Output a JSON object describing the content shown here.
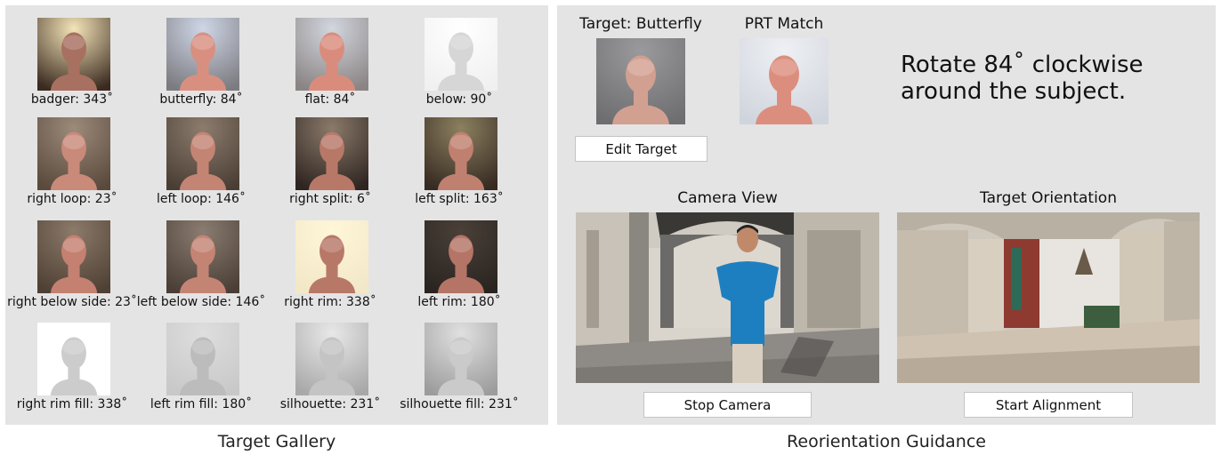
{
  "gallery": {
    "caption": "Target Gallery",
    "items": [
      {
        "label": "badger: 343˚",
        "bg": "#3a2a20",
        "skin": "#a87060",
        "light": "#f4e4b8"
      },
      {
        "label": "butterfly: 84˚",
        "bg": "#7b7b80",
        "skin": "#d98f80",
        "light": "#cfd6e6"
      },
      {
        "label": "flat: 84˚",
        "bg": "#8a8484",
        "skin": "#da8c7c",
        "light": "#d2d6de"
      },
      {
        "label": "below: 90˚",
        "bg": "#f0f0f0",
        "skin": "#d6d6d6",
        "light": "#ffffff"
      },
      {
        "label": "right loop: 23˚",
        "bg": "#5a4a3c",
        "skin": "#c98a7a",
        "light": "#9c8a7a"
      },
      {
        "label": "left loop: 146˚",
        "bg": "#4a3e34",
        "skin": "#c48474",
        "light": "#8c7c6e"
      },
      {
        "label": "right split: 6˚",
        "bg": "#2e2420",
        "skin": "#b87868",
        "light": "#8a7a6a"
      },
      {
        "label": "left split: 163˚",
        "bg": "#362a22",
        "skin": "#c08070",
        "light": "#8c8060"
      },
      {
        "label": "right below side: 23˚",
        "bg": "#4e4034",
        "skin": "#c48070",
        "light": "#8c7a6a"
      },
      {
        "label": "left below side: 146˚",
        "bg": "#4a3e36",
        "skin": "#c48474",
        "light": "#8a7c70"
      },
      {
        "label": "right rim: 338˚",
        "bg": "#f2e8c8",
        "skin": "#b87868",
        "light": "#fff6d8"
      },
      {
        "label": "left rim: 180˚",
        "bg": "#2a2420",
        "skin": "#b47466",
        "light": "#4a4038"
      },
      {
        "label": "right rim fill: 338˚",
        "bg": "#ffffff",
        "skin": "#cccccc",
        "light": "#ffffff"
      },
      {
        "label": "left rim fill: 180˚",
        "bg": "#c8c8c8",
        "skin": "#bcbcbc",
        "light": "#dedede"
      },
      {
        "label": "silhouette: 231˚",
        "bg": "#a8a8a8",
        "skin": "#c4c4c4",
        "light": "#e8e8e8"
      },
      {
        "label": "silhouette fill: 231˚",
        "bg": "#9c9c9c",
        "skin": "#cacaca",
        "light": "#e0e0e0"
      }
    ]
  },
  "guidance": {
    "caption": "Reorientation Guidance",
    "target_title": "Target: Butterfly",
    "prt_title": "PRT Match",
    "instruction": "Rotate 84˚ clockwise around the subject.",
    "edit_button": "Edit Target",
    "camera_title": "Camera View",
    "orientation_title": "Target Orientation",
    "stop_button": "Stop Camera",
    "start_button": "Start Alignment",
    "target_face": {
      "bg": "#6e6e70",
      "skin": "#d2a090",
      "light": "#9a9a9c"
    },
    "prt_face": {
      "bg": "#d0d4dc",
      "skin": "#dc8e7e",
      "light": "#eef0f4"
    }
  }
}
